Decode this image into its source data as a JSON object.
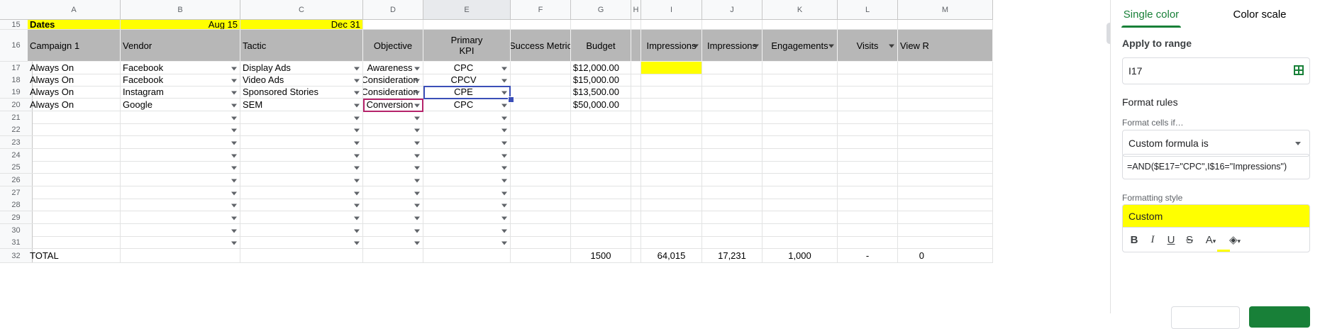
{
  "columns": [
    "A",
    "B",
    "C",
    "D",
    "E",
    "F",
    "G",
    "H",
    "I",
    "J",
    "K",
    "L",
    "M"
  ],
  "selected_column": "E",
  "rows": {
    "r15": {
      "num": "15",
      "a": "Dates",
      "b": "Aug  15",
      "c": "Dec  31"
    },
    "r16": {
      "num": "16",
      "campaign": "Campaign 1",
      "vendor": "Vendor",
      "tactic": "Tactic",
      "objective": "Objective",
      "kpi": "Primary\nKPI",
      "success": "Success Metric",
      "budget": "Budget",
      "impressions1": "Impressions",
      "impressions2": "Impressions",
      "engagements": "Engagements",
      "visits": "Visits",
      "viewr": "View R"
    },
    "data": [
      {
        "num": "17",
        "campaign": "Always On",
        "vendor": "Facebook",
        "tactic": "Display Ads",
        "objective": "Awareness",
        "kpi": "CPC",
        "budget": "$12,000.00"
      },
      {
        "num": "18",
        "campaign": "Always On",
        "vendor": "Facebook",
        "tactic": "Video Ads",
        "objective": "Consideration",
        "kpi": "CPCV",
        "budget": "$15,000.00"
      },
      {
        "num": "19",
        "campaign": "Always On",
        "vendor": "Instagram",
        "tactic": "Sponsored Stories",
        "objective": "Consideration",
        "kpi": "CPE",
        "budget": "$13,500.00"
      },
      {
        "num": "20",
        "campaign": "Always On",
        "vendor": "Google",
        "tactic": "SEM",
        "objective": "Conversion",
        "kpi": "CPC",
        "budget": "$50,000.00"
      }
    ],
    "empty": [
      "21",
      "22",
      "23",
      "24",
      "25",
      "26",
      "27",
      "28",
      "29",
      "30",
      "31"
    ],
    "total": {
      "num": "32",
      "label": "TOTAL",
      "budget": "1500",
      "impressions1": "64,015",
      "impressions2": "17,231",
      "engagements": "1,000",
      "visits": "-",
      "viewr": "0"
    }
  },
  "panel": {
    "tab_single": "Single color",
    "tab_scale": "Color scale",
    "apply_label": "Apply to range",
    "range_value": "I17",
    "format_rules": "Format rules",
    "format_cells_if": "Format cells if…",
    "condition": "Custom formula is",
    "formula": "=AND($E17=\"CPC\",I$16=\"Impressions\")",
    "formatting_style": "Formatting style",
    "style_name": "Custom",
    "bold": "B",
    "italic": "I",
    "underline": "U",
    "strike": "S",
    "text_color": "A",
    "fill_color": "◈"
  },
  "colors": {
    "highlight": "#ffff00",
    "header_gray": "#b7b7b7",
    "accent_green": "#188038",
    "selection_blue": "#3b4fb8"
  }
}
